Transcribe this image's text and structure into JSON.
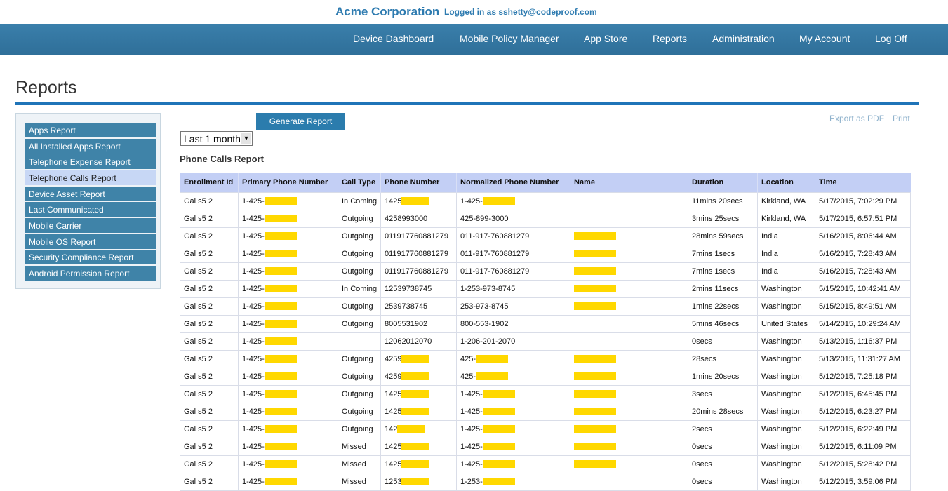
{
  "header": {
    "company": "Acme Corporation",
    "logged_in": "Logged in as sshetty@codeproof.com"
  },
  "nav": [
    {
      "label": "Device Dashboard"
    },
    {
      "label": "Mobile Policy Manager"
    },
    {
      "label": "App Store"
    },
    {
      "label": "Reports"
    },
    {
      "label": "Administration"
    },
    {
      "label": "My Account"
    },
    {
      "label": "Log Off"
    }
  ],
  "page": {
    "title": "Reports"
  },
  "sidebar": {
    "items": [
      {
        "label": "Apps Report",
        "active": false
      },
      {
        "label": "All Installed Apps Report",
        "active": false
      },
      {
        "label": "Telephone Expense Report",
        "active": false
      },
      {
        "label": "Telephone Calls Report",
        "active": true
      },
      {
        "label": "Device Asset Report",
        "active": false
      },
      {
        "label": "Last Communicated",
        "active": false
      },
      {
        "label": "Mobile Carrier",
        "active": false
      },
      {
        "label": "Mobile OS Report",
        "active": false
      },
      {
        "label": "Security Compliance Report",
        "active": false
      },
      {
        "label": "Android Permission Report",
        "active": false
      }
    ]
  },
  "controls": {
    "generate_label": "Generate Report",
    "period_value": "Last 1 month",
    "export_pdf": "Export as PDF",
    "print": "Print"
  },
  "report": {
    "heading": "Phone Calls Report",
    "columns": [
      "Enrollment Id",
      "Primary Phone Number",
      "Call Type",
      "Phone Number",
      "Normalized Phone Number",
      "Name",
      "Duration",
      "Location",
      "Time"
    ],
    "redaction_color": "#ffd800",
    "rows": [
      {
        "id": "Gal s5 2",
        "primary": "1-425-",
        "type": "In Coming",
        "phone": "1425",
        "norm": "1-425-",
        "name": "",
        "name_redacted": false,
        "phone_redacted": true,
        "norm_redacted": true,
        "duration": "11mins 20secs",
        "location": "Kirkland, WA",
        "time": "5/17/2015, 7:02:29 PM"
      },
      {
        "id": "Gal s5 2",
        "primary": "1-425-",
        "type": "Outgoing",
        "phone": "4258993000",
        "norm": "425-899-3000",
        "name": "",
        "name_redacted": false,
        "phone_redacted": false,
        "norm_redacted": false,
        "duration": "3mins 25secs",
        "location": "Kirkland, WA",
        "time": "5/17/2015, 6:57:51 PM"
      },
      {
        "id": "Gal s5 2",
        "primary": "1-425-",
        "type": "Outgoing",
        "phone": "011917760881279",
        "norm": "011-917-760881279",
        "name": "",
        "name_redacted": true,
        "phone_redacted": false,
        "norm_redacted": false,
        "duration": "28mins 59secs",
        "location": "India",
        "time": "5/16/2015, 8:06:44 AM"
      },
      {
        "id": "Gal s5 2",
        "primary": "1-425-",
        "type": "Outgoing",
        "phone": "011917760881279",
        "norm": "011-917-760881279",
        "name": "",
        "name_redacted": true,
        "phone_redacted": false,
        "norm_redacted": false,
        "duration": "7mins 1secs",
        "location": "India",
        "time": "5/16/2015, 7:28:43 AM"
      },
      {
        "id": "Gal s5 2",
        "primary": "1-425-",
        "type": "Outgoing",
        "phone": "011917760881279",
        "norm": "011-917-760881279",
        "name": "",
        "name_redacted": true,
        "phone_redacted": false,
        "norm_redacted": false,
        "duration": "7mins 1secs",
        "location": "India",
        "time": "5/16/2015, 7:28:43 AM"
      },
      {
        "id": "Gal s5 2",
        "primary": "1-425-",
        "type": "In Coming",
        "phone": "12539738745",
        "norm": "1-253-973-8745",
        "name": "",
        "name_redacted": true,
        "phone_redacted": false,
        "norm_redacted": false,
        "duration": "2mins 11secs",
        "location": "Washington",
        "time": "5/15/2015, 10:42:41 AM"
      },
      {
        "id": "Gal s5 2",
        "primary": "1-425-",
        "type": "Outgoing",
        "phone": "2539738745",
        "norm": "253-973-8745",
        "name": "",
        "name_redacted": true,
        "phone_redacted": false,
        "norm_redacted": false,
        "duration": "1mins 22secs",
        "location": "Washington",
        "time": "5/15/2015, 8:49:51 AM"
      },
      {
        "id": "Gal s5 2",
        "primary": "1-425-",
        "type": "Outgoing",
        "phone": "8005531902",
        "norm": "800-553-1902",
        "name": "",
        "name_redacted": false,
        "phone_redacted": false,
        "norm_redacted": false,
        "duration": "5mins 46secs",
        "location": "United States",
        "time": "5/14/2015, 10:29:24 AM"
      },
      {
        "id": "Gal s5 2",
        "primary": "1-425-",
        "type": "",
        "phone": "12062012070",
        "norm": "1-206-201-2070",
        "name": "",
        "name_redacted": false,
        "phone_redacted": false,
        "norm_redacted": false,
        "duration": "0secs",
        "location": "Washington",
        "time": "5/13/2015, 1:16:37 PM"
      },
      {
        "id": "Gal s5 2",
        "primary": "1-425-",
        "type": "Outgoing",
        "phone": "4259",
        "norm": "425-",
        "name": "",
        "name_redacted": true,
        "phone_redacted": true,
        "norm_redacted": true,
        "duration": "28secs",
        "location": "Washington",
        "time": "5/13/2015, 11:31:27 AM"
      },
      {
        "id": "Gal s5 2",
        "primary": "1-425-",
        "type": "Outgoing",
        "phone": "4259",
        "norm": "425-",
        "name": "",
        "name_redacted": true,
        "phone_redacted": true,
        "norm_redacted": true,
        "duration": "1mins 20secs",
        "location": "Washington",
        "time": "5/12/2015, 7:25:18 PM"
      },
      {
        "id": "Gal s5 2",
        "primary": "1-425-",
        "type": "Outgoing",
        "phone": "1425",
        "norm": "1-425-",
        "name": "",
        "name_redacted": true,
        "phone_redacted": true,
        "norm_redacted": true,
        "duration": "3secs",
        "location": "Washington",
        "time": "5/12/2015, 6:45:45 PM"
      },
      {
        "id": "Gal s5 2",
        "primary": "1-425-",
        "type": "Outgoing",
        "phone": "1425",
        "norm": "1-425-",
        "name": "",
        "name_redacted": true,
        "phone_redacted": true,
        "norm_redacted": true,
        "duration": "20mins 28secs",
        "location": "Washington",
        "time": "5/12/2015, 6:23:27 PM"
      },
      {
        "id": "Gal s5 2",
        "primary": "1-425-",
        "type": "Outgoing",
        "phone": "142",
        "norm": "1-425-",
        "name": "",
        "name_redacted": true,
        "phone_redacted": true,
        "norm_redacted": true,
        "duration": "2secs",
        "location": "Washington",
        "time": "5/12/2015, 6:22:49 PM"
      },
      {
        "id": "Gal s5 2",
        "primary": "1-425-",
        "type": "Missed",
        "phone": "1425",
        "norm": "1-425-",
        "name": "",
        "name_redacted": true,
        "phone_redacted": true,
        "norm_redacted": true,
        "duration": "0secs",
        "location": "Washington",
        "time": "5/12/2015, 6:11:09 PM"
      },
      {
        "id": "Gal s5 2",
        "primary": "1-425-",
        "type": "Missed",
        "phone": "1425",
        "norm": "1-425-",
        "name": "",
        "name_redacted": true,
        "phone_redacted": true,
        "norm_redacted": true,
        "duration": "0secs",
        "location": "Washington",
        "time": "5/12/2015, 5:28:42 PM"
      },
      {
        "id": "Gal s5 2",
        "primary": "1-425-",
        "type": "Missed",
        "phone": "1253",
        "norm": "1-253-",
        "name": "",
        "name_redacted": false,
        "phone_redacted": true,
        "norm_redacted": true,
        "duration": "0secs",
        "location": "Washington",
        "time": "5/12/2015, 3:59:06 PM"
      }
    ]
  }
}
